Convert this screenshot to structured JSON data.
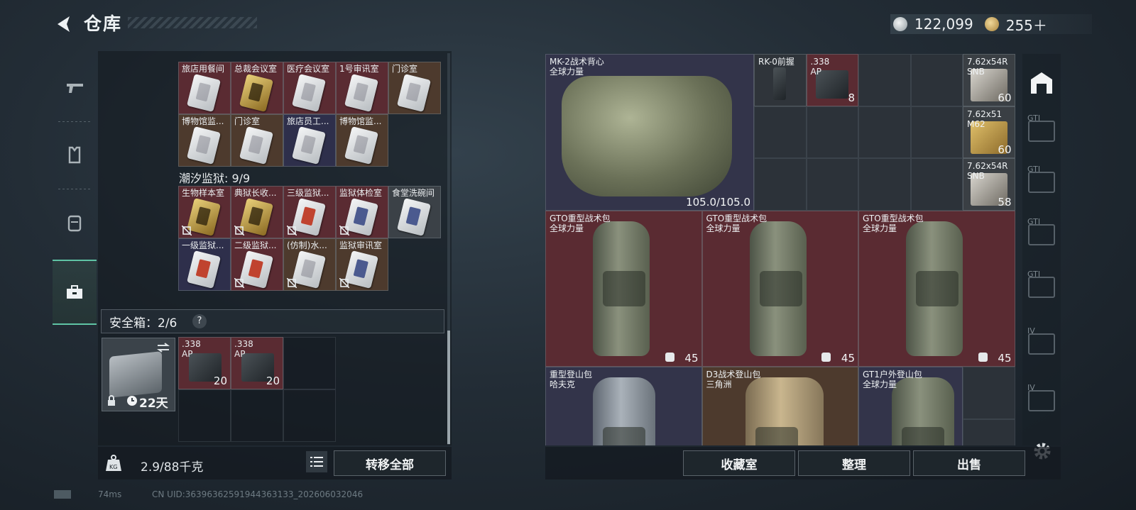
{
  "header": {
    "title": "仓库",
    "silver": "122,099",
    "gold": "255＋"
  },
  "nav": {
    "items": [
      "weapon",
      "armor",
      "backpack",
      "keys"
    ],
    "active": "keys"
  },
  "collections": {
    "group1_rows": [
      [
        {
          "label": "旅店用餐间",
          "bg": "red",
          "card": "white"
        },
        {
          "label": "总裁会议室",
          "bg": "red",
          "card": "gold"
        },
        {
          "label": "医疗会议室",
          "bg": "red",
          "card": "white"
        },
        {
          "label": "1号审讯室",
          "bg": "red",
          "card": "white"
        },
        {
          "label": "门诊室",
          "bg": "brown",
          "card": "white"
        }
      ],
      [
        {
          "label": "博物馆监...",
          "bg": "brown",
          "card": "white"
        },
        {
          "label": "门诊室",
          "bg": "brown",
          "card": "white"
        },
        {
          "label": "旅店员工...",
          "bg": "navy",
          "card": "white"
        },
        {
          "label": "博物馆监...",
          "bg": "brown",
          "card": "white"
        }
      ]
    ],
    "group2_title": "潮汐监狱: 9/9",
    "group2_rows": [
      [
        {
          "label": "生物样本室",
          "bg": "red",
          "card": "gold",
          "nobind": true
        },
        {
          "label": "典狱长收...",
          "bg": "red",
          "card": "gold",
          "nobind": true
        },
        {
          "label": "三级监狱...",
          "bg": "red",
          "card": "redc",
          "nobind": true
        },
        {
          "label": "监狱体检室",
          "bg": "red",
          "card": "bluec",
          "nobind": true
        },
        {
          "label": "食堂洗碗间",
          "bg": "gray",
          "card": "bluec",
          "nobind": false
        }
      ],
      [
        {
          "label": "一级监狱...",
          "bg": "navy",
          "card": "redc",
          "nobind": false
        },
        {
          "label": "二级监狱...",
          "bg": "red",
          "card": "redc",
          "nobind": true
        },
        {
          "label": "(仿制)水...",
          "bg": "brown",
          "card": "white",
          "nobind": true
        },
        {
          "label": "监狱审讯室",
          "bg": "brown",
          "card": "bluec",
          "nobind": true
        }
      ]
    ]
  },
  "safebox": {
    "label": "安全箱：2/6",
    "help": "?",
    "expiry": "22天",
    "items": [
      {
        "label": ".338\nAP",
        "count": "20"
      },
      {
        "label": ".338\nAP",
        "count": "20"
      }
    ]
  },
  "footer_left": {
    "weight": "2.9/88千克",
    "transfer_all": "转移全部",
    "ping": "74ms",
    "uid": "CN UID:36396362591944363133_202606032046"
  },
  "stash": {
    "vest": {
      "label": "MK-2战术背心\n全球力量",
      "durability": "105.0/105.0"
    },
    "grip": {
      "label": "RK-0前握"
    },
    "ammo_338": {
      "label": ".338\nAP",
      "count": "8"
    },
    "ammo_side": [
      {
        "label": "7.62x54R\nSNB",
        "count": "60"
      },
      {
        "label": "7.62x51\nM62",
        "count": "60"
      },
      {
        "label": "7.62x54R\nSNB",
        "count": "58"
      }
    ],
    "packs": [
      {
        "label": "GTO重型战术包\n全球力量",
        "count": "45"
      },
      {
        "label": "GTO重型战术包\n全球力量",
        "count": "45"
      },
      {
        "label": "GTO重型战术包\n全球力量",
        "count": "45"
      }
    ],
    "packs2": [
      {
        "label": "重型登山包\n哈夫克"
      },
      {
        "label": "D3战术登山包\n三角洲"
      },
      {
        "label": "GT1户外登山包\n全球力量"
      }
    ]
  },
  "side_tabs": [
    "GTI",
    "GTI",
    "GTI",
    "GTI",
    "IV",
    "IV"
  ],
  "footer_right": {
    "buttons": [
      "收藏室",
      "整理",
      "出售"
    ]
  }
}
